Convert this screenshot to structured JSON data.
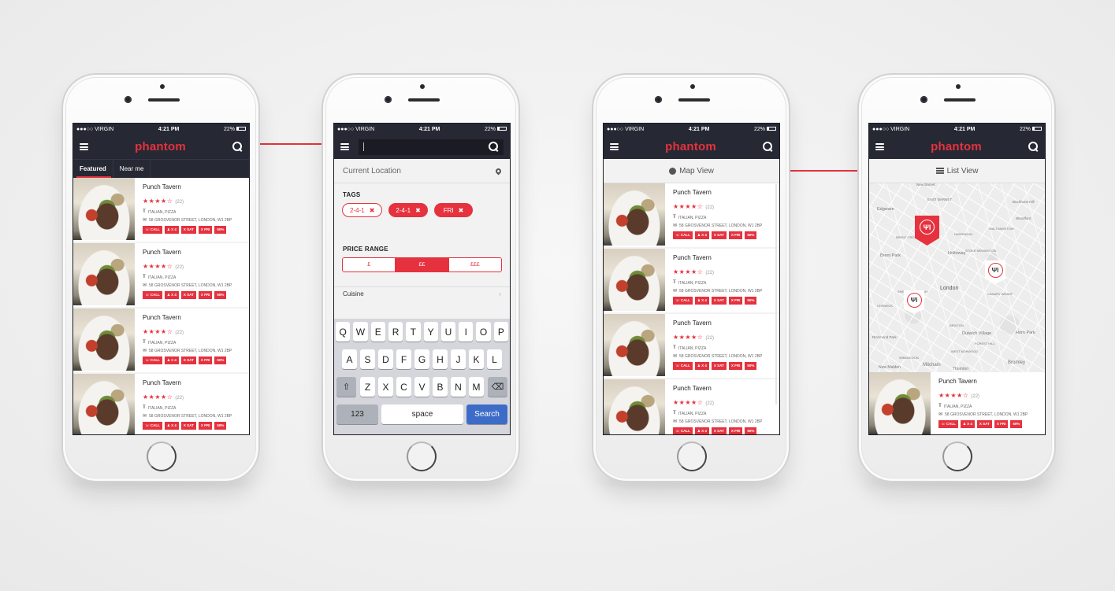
{
  "status_bar": {
    "carrier": "●●●○○ VIRGIN",
    "time": "4:21 PM",
    "battery": "22%"
  },
  "app": {
    "logo": "phantom",
    "accent_color": "#e5323e",
    "nav_color": "#262833"
  },
  "screen1": {
    "tabs": [
      {
        "label": "Featured",
        "active": true
      },
      {
        "label": "Near me",
        "active": false
      }
    ]
  },
  "restaurant": {
    "name": "Punch Tavern",
    "rating": 4.5,
    "stars": "★★★★☆",
    "review_count": "(22)",
    "cuisine": "ITALIAN, PIZZA",
    "address": "58 GROSVENOR STREET, LONDON, W1 2BP",
    "chips": [
      "☏ CALL",
      "♟ X 4",
      "X SAT",
      "X FRI",
      "50%"
    ]
  },
  "screen2": {
    "search_value": "",
    "current_location": "Current Location",
    "tags_title": "TAGS",
    "tags": [
      {
        "label": "2-4-1",
        "style": "outline"
      },
      {
        "label": "2-4-1",
        "style": "fill"
      },
      {
        "label": "FRI",
        "style": "fill"
      }
    ],
    "tag_remove": "✖",
    "price_title": "PRICE RANGE",
    "price_options": [
      {
        "label": "£",
        "selected": false
      },
      {
        "label": "££",
        "selected": true
      },
      {
        "label": "£££",
        "selected": false
      }
    ],
    "cuisine_label": "Cuisine",
    "chevron": "›",
    "keyboard": {
      "row1": [
        "Q",
        "W",
        "E",
        "R",
        "T",
        "Y",
        "U",
        "I",
        "O",
        "P"
      ],
      "row2": [
        "A",
        "S",
        "D",
        "F",
        "G",
        "H",
        "J",
        "K",
        "L"
      ],
      "row3": [
        "Z",
        "X",
        "C",
        "V",
        "B",
        "N",
        "M"
      ],
      "shift": "⇧",
      "backspace": "⌫",
      "numbers": "123",
      "space": "space",
      "action": "Search"
    }
  },
  "screen3": {
    "toggle_label": "Map View"
  },
  "screen4": {
    "toggle_label": "List View",
    "map_labels": [
      {
        "text": "New Barnet"
      },
      {
        "text": "EAST BARNET"
      },
      {
        "text": "Edgware"
      },
      {
        "text": "Buckhurst Hill"
      },
      {
        "text": "Woodford"
      },
      {
        "text": "WALTHAMSTOW"
      },
      {
        "text": "HARRINGAY"
      },
      {
        "text": "BRENT CROSS"
      },
      {
        "text": "Brent Park"
      },
      {
        "text": "Holloway"
      },
      {
        "text": "STOKE NEWINGTON"
      },
      {
        "text": "London"
      },
      {
        "text": "SHEPHERD'S BUSH"
      },
      {
        "text": "CHISWICK"
      },
      {
        "text": "CANARY WHARF"
      },
      {
        "text": "BRIXTON"
      },
      {
        "text": "Dulwich Village"
      },
      {
        "text": "FOREST HILL"
      },
      {
        "text": "Horn Park"
      },
      {
        "text": "WEST NORWOOD"
      },
      {
        "text": "WIMBLEDON"
      },
      {
        "text": "Richmond Park"
      },
      {
        "text": "Mitcham"
      },
      {
        "text": "Thornton"
      },
      {
        "text": "Bromley"
      },
      {
        "text": "New Malden"
      }
    ],
    "marker_icon": "ΨΙ"
  }
}
